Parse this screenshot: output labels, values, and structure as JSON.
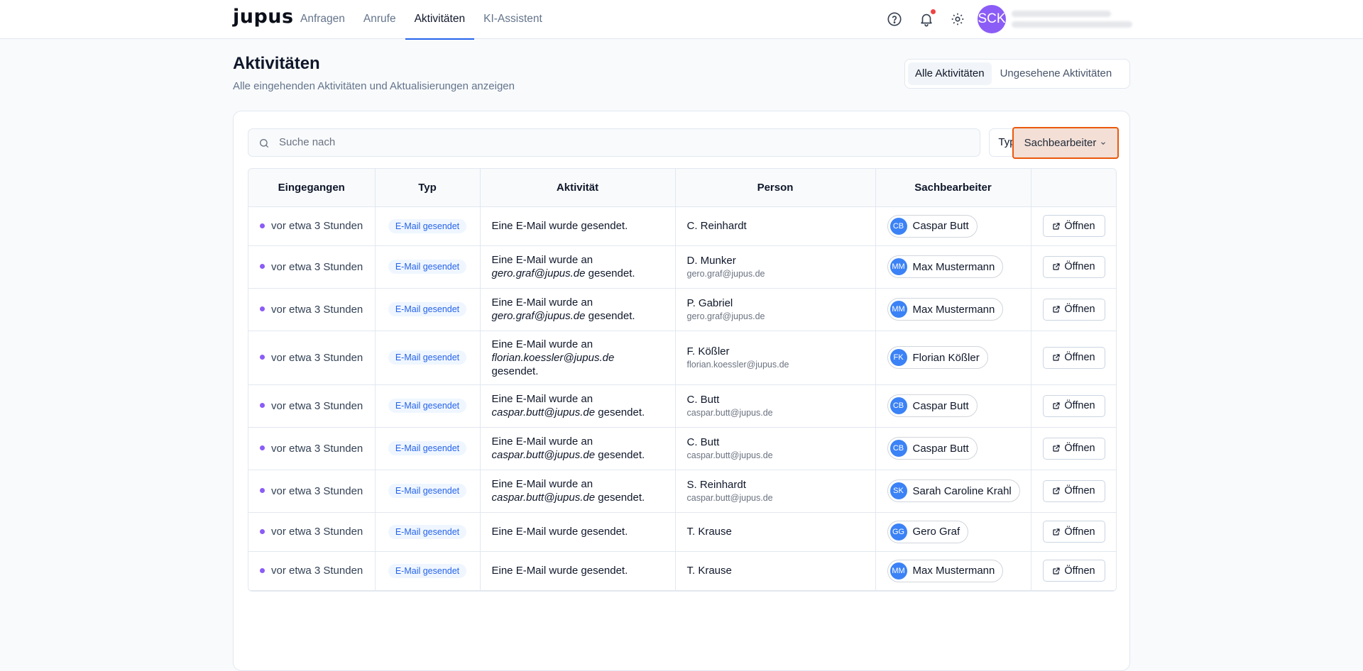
{
  "brand": {
    "logo": "jupus"
  },
  "nav": {
    "items": [
      {
        "label": "Anfragen",
        "active": false
      },
      {
        "label": "Anrufe",
        "active": false
      },
      {
        "label": "Aktivitäten",
        "active": true
      },
      {
        "label": "KI-Assistent",
        "active": false
      }
    ]
  },
  "user": {
    "initials": "SCK"
  },
  "header": {
    "title": "Aktivitäten",
    "subtitle": "Alle eingehenden Aktivitäten und Aktualisierungen anzeigen",
    "filter_all": "Alle Aktivitäten",
    "filter_unseen": "Ungesehene Aktivitäten"
  },
  "search": {
    "placeholder": "Suche nach"
  },
  "filters": {
    "typ": "Typ",
    "sachbearbeiter": "Sachbearbeiter"
  },
  "table": {
    "columns": [
      "Eingegangen",
      "Typ",
      "Aktivität",
      "Person",
      "Sachbearbeiter",
      ""
    ],
    "open_label": "Öffnen",
    "rows": [
      {
        "received": "vor etwa 3 Stunden",
        "type": "E-Mail gesendet",
        "activity_pre": "Eine E-Mail wurde gesendet.",
        "activity_email": "",
        "activity_post": "",
        "person": "C. Reinhardt",
        "person_email": "",
        "agent_initials": "CB",
        "agent": "Caspar Butt"
      },
      {
        "received": "vor etwa 3 Stunden",
        "type": "E-Mail gesendet",
        "activity_pre": "Eine E-Mail wurde an",
        "activity_email": "gero.graf@jupus.de",
        "activity_post": " gesendet.",
        "person": "D. Munker",
        "person_email": "gero.graf@jupus.de",
        "agent_initials": "MM",
        "agent": "Max Mustermann"
      },
      {
        "received": "vor etwa 3 Stunden",
        "type": "E-Mail gesendet",
        "activity_pre": "Eine E-Mail wurde an",
        "activity_email": "gero.graf@jupus.de",
        "activity_post": " gesendet.",
        "person": "P. Gabriel",
        "person_email": "gero.graf@jupus.de",
        "agent_initials": "MM",
        "agent": "Max Mustermann"
      },
      {
        "received": "vor etwa 3 Stunden",
        "type": "E-Mail gesendet",
        "activity_pre": "Eine E-Mail wurde an",
        "activity_email": "florian.koessler@jupus.de",
        "activity_post": " gesendet.",
        "person": "F. Kößler",
        "person_email": "florian.koessler@jupus.de",
        "agent_initials": "FK",
        "agent": "Florian Kößler"
      },
      {
        "received": "vor etwa 3 Stunden",
        "type": "E-Mail gesendet",
        "activity_pre": "Eine E-Mail wurde an",
        "activity_email": "caspar.butt@jupus.de",
        "activity_post": " gesendet.",
        "person": "C. Butt",
        "person_email": "caspar.butt@jupus.de",
        "agent_initials": "CB",
        "agent": "Caspar Butt"
      },
      {
        "received": "vor etwa 3 Stunden",
        "type": "E-Mail gesendet",
        "activity_pre": "Eine E-Mail wurde an",
        "activity_email": "caspar.butt@jupus.de",
        "activity_post": " gesendet.",
        "person": "C. Butt",
        "person_email": "caspar.butt@jupus.de",
        "agent_initials": "CB",
        "agent": "Caspar Butt"
      },
      {
        "received": "vor etwa 3 Stunden",
        "type": "E-Mail gesendet",
        "activity_pre": "Eine E-Mail wurde an",
        "activity_email": "caspar.butt@jupus.de",
        "activity_post": " gesendet.",
        "person": "S. Reinhardt",
        "person_email": "caspar.butt@jupus.de",
        "agent_initials": "SK",
        "agent": "Sarah Caroline Krahl"
      },
      {
        "received": "vor etwa 3 Stunden",
        "type": "E-Mail gesendet",
        "activity_pre": "Eine E-Mail wurde gesendet.",
        "activity_email": "",
        "activity_post": "",
        "person": "T. Krause",
        "person_email": "",
        "agent_initials": "GG",
        "agent": "Gero Graf"
      },
      {
        "received": "vor etwa 3 Stunden",
        "type": "E-Mail gesendet",
        "activity_pre": "Eine E-Mail wurde gesendet.",
        "activity_email": "",
        "activity_post": "",
        "person": "T. Krause",
        "person_email": "",
        "agent_initials": "MM",
        "agent": "Max Mustermann"
      }
    ]
  },
  "colors": {
    "accent": "#2563eb",
    "unread_dot": "#8b5cf6",
    "highlight_border": "#ea580c"
  }
}
